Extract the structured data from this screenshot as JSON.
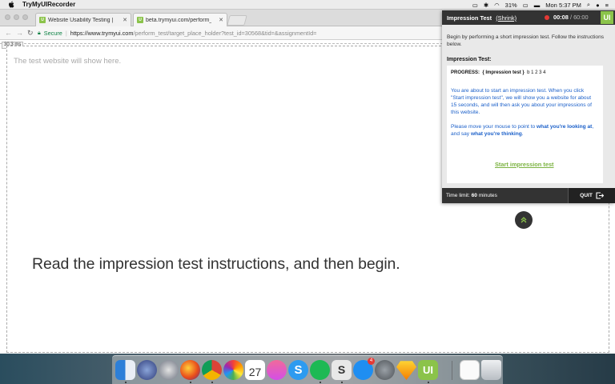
{
  "menubar": {
    "app_name": "TryMyUIRecorder",
    "battery": "31%",
    "clock": "Mon 5:37 PM"
  },
  "browser": {
    "tabs": [
      {
        "title": "Website Usability Testing | Use"
      },
      {
        "title": "beta.trymyui.com/perform_tes"
      }
    ],
    "secure_label": "Secure",
    "url_host": "https://www.trymyui.com",
    "url_path": "/perform_test/target_place_holder?test_id=30568&tid=&assignmentId=",
    "ruler_label": "30.3 ms"
  },
  "page": {
    "placeholder": "The test website will show here.",
    "message": "Read the impression test instructions, and then begin."
  },
  "panel": {
    "title": "Impression Test",
    "shrink": "(Shrink)",
    "timer_current": "00:08",
    "timer_total": "/ 60:00",
    "logo": "UI",
    "intro": "Begin by performing a short impression test. Follow the instructions below.",
    "section_heading": "Impression Test:",
    "progress_label": "PROGRESS:",
    "progress_current": "{ Impression test }",
    "progress_steps": "b 1 2 3 4",
    "desc1": "You are about to start an impression test. When you click \"Start impression test\", we will show you a website for about 15 seconds, and will then ask you about your impressions of this website.",
    "desc2_a": "Please move your mouse to point to ",
    "desc2_b": "what you're looking at",
    "desc2_c": ", and say ",
    "desc2_d": "what you're thinking",
    "desc2_e": ".",
    "start_link": "Start impression test",
    "time_limit_label": "Time limit: ",
    "time_limit_value": "60",
    "time_limit_unit": " minutes",
    "quit": "QUIT"
  },
  "dock": {
    "calendar_day": "27",
    "appstore_badge": "4"
  },
  "colors": {
    "accent_green": "#8bc34a",
    "link_blue": "#1a5fc9",
    "panel_dark": "#333333",
    "record_red": "#e53935"
  }
}
